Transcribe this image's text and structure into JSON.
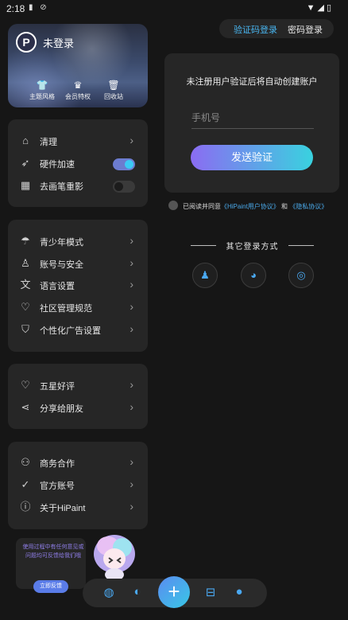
{
  "status_bar": {
    "time": "2:18",
    "left_icons": "▮ ⊘",
    "right_icons": "▼◢▯"
  },
  "tabs": {
    "active": "验证码登录",
    "inactive": "密码登录"
  },
  "profile": {
    "logo": "P",
    "name": "未登录",
    "items": [
      {
        "label": "主题风格",
        "icon": "shirt-icon",
        "glyph": "👕"
      },
      {
        "label": "会员特权",
        "icon": "crown-icon",
        "glyph": "♛"
      },
      {
        "label": "回收站",
        "icon": "trash-icon",
        "glyph": "🗑"
      }
    ]
  },
  "settings": {
    "clean": {
      "label": "清理",
      "icon": "broom-icon",
      "glyph": "⌂"
    },
    "hw_accel": {
      "label": "硬件加速",
      "icon": "rocket-icon",
      "glyph": "➶",
      "on": true
    },
    "stroke_shadow": {
      "label": "去画笔重影",
      "icon": "brush-icon",
      "glyph": "▦",
      "on": false
    }
  },
  "menu2": [
    {
      "label": "青少年模式",
      "icon": "umbrella-icon",
      "glyph": "☂"
    },
    {
      "label": "账号与安全",
      "icon": "user-icon",
      "glyph": "♙"
    },
    {
      "label": "语言设置",
      "icon": "language-icon",
      "glyph": "文"
    },
    {
      "label": "社区管理规范",
      "icon": "community-icon",
      "glyph": "♡"
    },
    {
      "label": "个性化广告设置",
      "icon": "shield-icon",
      "glyph": "⛉"
    }
  ],
  "menu3": [
    {
      "label": "五星好评",
      "icon": "heart-icon",
      "glyph": "♡"
    },
    {
      "label": "分享给朋友",
      "icon": "share-icon",
      "glyph": "⋖"
    }
  ],
  "menu4": [
    {
      "label": "商务合作",
      "icon": "handshake-icon",
      "glyph": "⚇"
    },
    {
      "label": "官方账号",
      "icon": "verified-icon",
      "glyph": "✓"
    },
    {
      "label": "关于HiPaint",
      "icon": "info-icon",
      "glyph": "ⓘ"
    }
  ],
  "login": {
    "title": "未注册用户验证后将自动创建账户",
    "phone_placeholder": "手机号",
    "send_label": "发送验证"
  },
  "agreement": {
    "prefix": "已阅读并同意",
    "user_agreement": "《HiPaint用户协议》",
    "and": "和",
    "privacy": "《隐私协议》"
  },
  "other_login": {
    "title": "其它登录方式",
    "providers": [
      {
        "name": "qq",
        "icon": "qq-icon",
        "glyph": "♟",
        "color": "#4aa8f0"
      },
      {
        "name": "wechat",
        "icon": "wechat-icon",
        "glyph": "◕",
        "color": "#4aa8f0"
      },
      {
        "name": "weibo",
        "icon": "weibo-icon",
        "glyph": "◎",
        "color": "#4aa8f0"
      }
    ]
  },
  "feedback": {
    "text": "使用过程中有任何意见或问题均可反馈给我们哦",
    "button": "立即反馈"
  },
  "bottom_nav": {
    "items": [
      {
        "icon": "palette-icon",
        "glyph": "◍"
      },
      {
        "icon": "planet-icon",
        "glyph": "◐"
      },
      {
        "icon": "shop-icon",
        "glyph": "⊟"
      },
      {
        "icon": "profile-icon",
        "glyph": "●"
      }
    ],
    "add_glyph": "+"
  },
  "colors": {
    "accent": "#48b5f0",
    "gradient_start": "#8b6cf2",
    "gradient_end": "#39d2df",
    "panel": "#262626",
    "background": "#161616"
  }
}
